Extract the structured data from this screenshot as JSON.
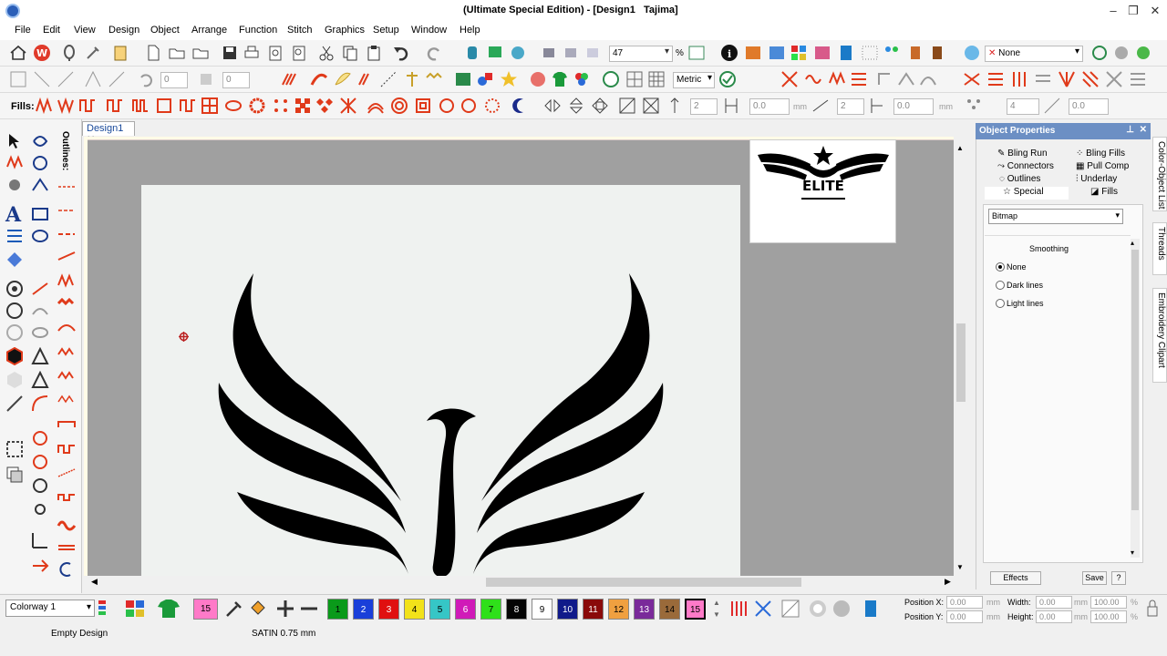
{
  "window": {
    "title": "(Ultimate Special Edition) - [Design1",
    "title_suffix": "Tajima]"
  },
  "menu": [
    "File",
    "Edit",
    "View",
    "Design",
    "Object",
    "Arrange",
    "Function",
    "Stitch",
    "Graphics",
    "Setup",
    "Window",
    "Help"
  ],
  "toolbar1": {
    "zoom_value": "47",
    "zoom_unit": "%",
    "color_none": "None"
  },
  "toolbar2": {
    "value1": "0",
    "value2": "0",
    "units": "Metric"
  },
  "toolbar3": {
    "fills_label": "Fills:",
    "v1": "2",
    "v2": "0.0",
    "v3": "mm",
    "v4": "2",
    "v5": "0.0",
    "v6": "mm",
    "v7": "4",
    "v8": "0.0"
  },
  "left": {
    "outlines_label": "Outlines:"
  },
  "document": {
    "tab": "Design1",
    "thumb_text": "ELITE"
  },
  "panel": {
    "title": "Object Properties",
    "tabs": [
      "Bling Run",
      "Bling Fills",
      "Connectors",
      "Pull Comp",
      "Outlines",
      "Underlay",
      "Special",
      "Fills"
    ],
    "mode": "Bitmap",
    "section": "Smoothing",
    "options": [
      "None",
      "Dark lines",
      "Light lines"
    ],
    "effects": "Effects",
    "save": "Save",
    "help": "?"
  },
  "sidetabs": [
    "Color-Object List",
    "Threads",
    "Embroidery Clipart"
  ],
  "bottom": {
    "colorway": "Colorway 1",
    "current_color": "15",
    "swatches": [
      {
        "n": "1",
        "c": "#0a9a1a",
        "t": "#000"
      },
      {
        "n": "2",
        "c": "#1a3fd9",
        "t": "#fff"
      },
      {
        "n": "3",
        "c": "#e01010",
        "t": "#fff"
      },
      {
        "n": "4",
        "c": "#f2e21a",
        "t": "#000"
      },
      {
        "n": "5",
        "c": "#36c6c6",
        "t": "#000"
      },
      {
        "n": "6",
        "c": "#d01ab8",
        "t": "#fff"
      },
      {
        "n": "7",
        "c": "#2fe01a",
        "t": "#000"
      },
      {
        "n": "8",
        "c": "#050505",
        "t": "#fff"
      },
      {
        "n": "9",
        "c": "#ffffff",
        "t": "#000"
      },
      {
        "n": "10",
        "c": "#101a8a",
        "t": "#fff"
      },
      {
        "n": "11",
        "c": "#8a0a0a",
        "t": "#fff"
      },
      {
        "n": "12",
        "c": "#f0a040",
        "t": "#000"
      },
      {
        "n": "13",
        "c": "#7a2a9a",
        "t": "#fff"
      },
      {
        "n": "14",
        "c": "#9a6a3a",
        "t": "#000"
      },
      {
        "n": "15",
        "c": "#ff7ac8",
        "t": "#000"
      }
    ],
    "pos_x_label": "Position X:",
    "pos_y_label": "Position Y:",
    "width_label": "Width:",
    "height_label": "Height:",
    "pos_x": "0.00",
    "pos_y": "0.00",
    "width": "0.00",
    "height": "0.00",
    "unit": "mm",
    "pct1": "100.00",
    "pct2": "100.00",
    "pct": "%"
  },
  "status": {
    "left": "Empty Design",
    "stitch": "SATIN  0.75 mm"
  }
}
